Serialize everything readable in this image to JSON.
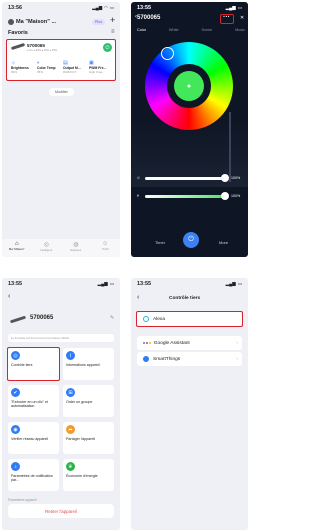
{
  "p1": {
    "status_time": "13:56",
    "home_title": "Ma \"Maison\" ...",
    "plus_badge": "Plus",
    "favorites_label": "Favoris",
    "device": {
      "name": "5700065",
      "meta": "● On  ● 99%  ● 65%  ● 55%",
      "controls": [
        {
          "label": "Brightness",
          "value": "99%"
        },
        {
          "label": "Color Temp",
          "value": "65%"
        },
        {
          "label": "Output M...",
          "value": "RGB/CCT"
        },
        {
          "label": "PWM Fre...",
          "value": "High Freq..."
        }
      ]
    },
    "modify_button": "Modifier",
    "nav": [
      {
        "label": "Ma \"Maison\"",
        "icon": "home-icon"
      },
      {
        "label": "Intelligent",
        "icon": "smart-icon"
      },
      {
        "label": "Espaces",
        "icon": "spaces-icon"
      },
      {
        "label": "Profil",
        "icon": "profile-icon"
      }
    ]
  },
  "p2": {
    "status_time": "13:55",
    "device_name": "5700065",
    "tabs": [
      "Color",
      "White",
      "Scene",
      "Music"
    ],
    "brightness_value": "100%",
    "saturation_value": "100%",
    "bottom": [
      "Timer",
      "More"
    ]
  },
  "p3": {
    "status_time": "13:55",
    "device_name": "5700065",
    "firmware_note": "Le firmware est fourni par le fournisseur officiel",
    "tiles": [
      {
        "label": "Contrôle tiers",
        "color": "#2e7cf6"
      },
      {
        "label": "Informations appareil",
        "color": "#2e7cf6"
      },
      {
        "label": "\"Exécuter en un clic\" et automatisation",
        "color": "#2e7cf6"
      },
      {
        "label": "Order un groupe",
        "color": "#2e7cf6"
      },
      {
        "label": "Vérifier réseau appareil",
        "color": "#2e7cf6"
      },
      {
        "label": "Partager l'appareil",
        "color": "#f39a2e"
      },
      {
        "label": "Paramètres de notification par...",
        "color": "#2e7cf6"
      },
      {
        "label": "Économie d'énergie",
        "color": "#2db34a"
      }
    ],
    "section_label": "Paramètres appareil",
    "remove_button": "Retirer l'appareil"
  },
  "p4": {
    "status_time": "13:55",
    "title": "Contrôle tiers",
    "services": [
      "Alexa",
      "Google Assistant",
      "SmartThings"
    ]
  }
}
